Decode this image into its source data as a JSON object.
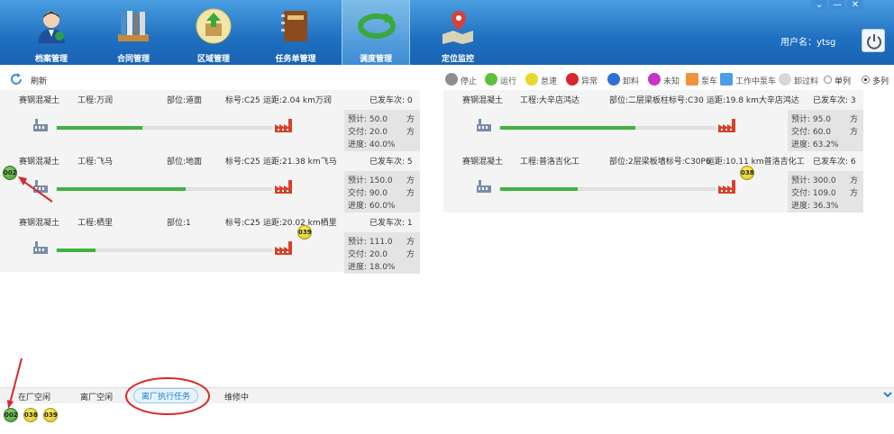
{
  "nav": [
    {
      "label": "档案管理",
      "icon": "user-archive-icon"
    },
    {
      "label": "合同管理",
      "icon": "contract-books-icon"
    },
    {
      "label": "区域管理",
      "icon": "region-box-icon"
    },
    {
      "label": "任务单管理",
      "icon": "task-notebook-icon"
    },
    {
      "label": "调度管理",
      "icon": "dispatch-arrow-icon"
    },
    {
      "label": "定位监控",
      "icon": "location-map-icon"
    }
  ],
  "user": {
    "label": "用户名：ytsg"
  },
  "window": {
    "min": "⌄",
    "restore": "—",
    "close": "✕"
  },
  "toolbar": {
    "refresh": "刷新",
    "legend": [
      {
        "label": "停止",
        "color": "#8f8f8f"
      },
      {
        "label": "运行",
        "color": "#5cc13a"
      },
      {
        "label": "怠速",
        "color": "#e8d82c"
      },
      {
        "label": "异常",
        "color": "#d8282c"
      },
      {
        "label": "卸料",
        "color": "#2f6fd8"
      },
      {
        "label": "未知",
        "color": "#c734c7"
      },
      {
        "label": "泵车",
        "color": "#f0923a"
      },
      {
        "label": "工作中泵车",
        "color": "#4a9ee8"
      },
      {
        "label": "卸过料",
        "color": "#d8d8d8"
      }
    ],
    "view_single": "单列",
    "view_multi": "多列"
  },
  "tasks": [
    {
      "company": "赛钢混凝土",
      "project": "工程:万润",
      "part": "部位:道面",
      "grade": "标号:C25",
      "distance": "运距:2.04  km万润",
      "trips": "已发车次: 0",
      "plan": "预计: 50.0",
      "delivered": "交付: 20.0",
      "progress_text": "进度: 40.0%",
      "unit": "方",
      "progress": 0.4,
      "trucks": []
    },
    {
      "company": "赛钢混凝土",
      "project": "工程:飞马",
      "part": "部位:地面",
      "grade": "标号:C25",
      "distance": "运距:21.38 km飞马",
      "trips": "已发车次: 5",
      "plan": "预计: 150.0",
      "delivered": "交付: 90.0",
      "progress_text": "进度: 60.0%",
      "unit": "方",
      "progress": 0.6,
      "trucks": [
        "002"
      ]
    },
    {
      "company": "赛钢混凝土",
      "project": "工程:栖里",
      "part": "部位:1",
      "grade": "标号:C25",
      "distance": "运距:20.02 km栖里",
      "trips": "已发车次: 1",
      "plan": "预计: 111.0",
      "delivered": "交付: 20.0",
      "progress_text": "进度: 18.0%",
      "unit": "方",
      "progress": 0.18,
      "trucks": [
        "039"
      ]
    },
    {
      "company": "赛钢混凝土",
      "project": "工程:大辛店鸿达",
      "part": "部位:二层梁板柱标号:C30",
      "grade": "",
      "distance": "运距:19.8  km大辛店鸿达",
      "trips": "已发车次: 3",
      "plan": "预计: 95.0",
      "delivered": "交付: 60.0",
      "progress_text": "进度: 63.2%",
      "unit": "方",
      "progress": 0.632,
      "trucks": []
    },
    {
      "company": "赛钢混凝土",
      "project": "工程:普洛吉化工",
      "part": "部位:2层梁板墙标号:C30P6",
      "grade": "",
      "distance": "运距:10.11 km普洛吉化工",
      "trips": "已发车次: 6",
      "plan": "预计: 300.0",
      "delivered": "交付: 109.0",
      "progress_text": "进度: 36.3%",
      "unit": "方",
      "progress": 0.363,
      "trucks": [
        "038"
      ]
    }
  ],
  "bottom": {
    "tabs": [
      "在厂空闲",
      "离厂空闲",
      "离厂执行任务",
      "维修中"
    ],
    "active_tab": 2,
    "trucks": [
      {
        "id": "002",
        "status": "green"
      },
      {
        "id": "038",
        "status": "yellow"
      },
      {
        "id": "039",
        "status": "yellow"
      }
    ]
  }
}
